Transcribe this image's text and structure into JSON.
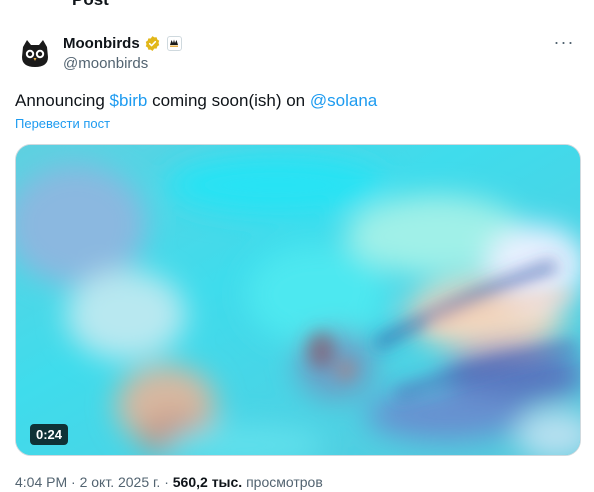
{
  "top_partial_text": "Post",
  "author": {
    "display_name": "Moonbirds",
    "handle": "@moonbirds",
    "verified_color": "#e2b719"
  },
  "menu": {
    "more_label": "···"
  },
  "post": {
    "text_prefix": "Announcing ",
    "cashtag": "$birb",
    "text_middle": " coming soon(ish) on ",
    "mention": "@solana",
    "translate_label": "Перевести пост"
  },
  "video": {
    "duration": "0:24"
  },
  "meta": {
    "time": "4:04 PM",
    "separator": " · ",
    "date": "2 окт. 2025 г.",
    "views_count": "560,2 тыс.",
    "views_label": "просмотров"
  },
  "colors": {
    "link": "#1d9bf0",
    "secondary_text": "#536471",
    "primary_text": "#0f1419"
  }
}
